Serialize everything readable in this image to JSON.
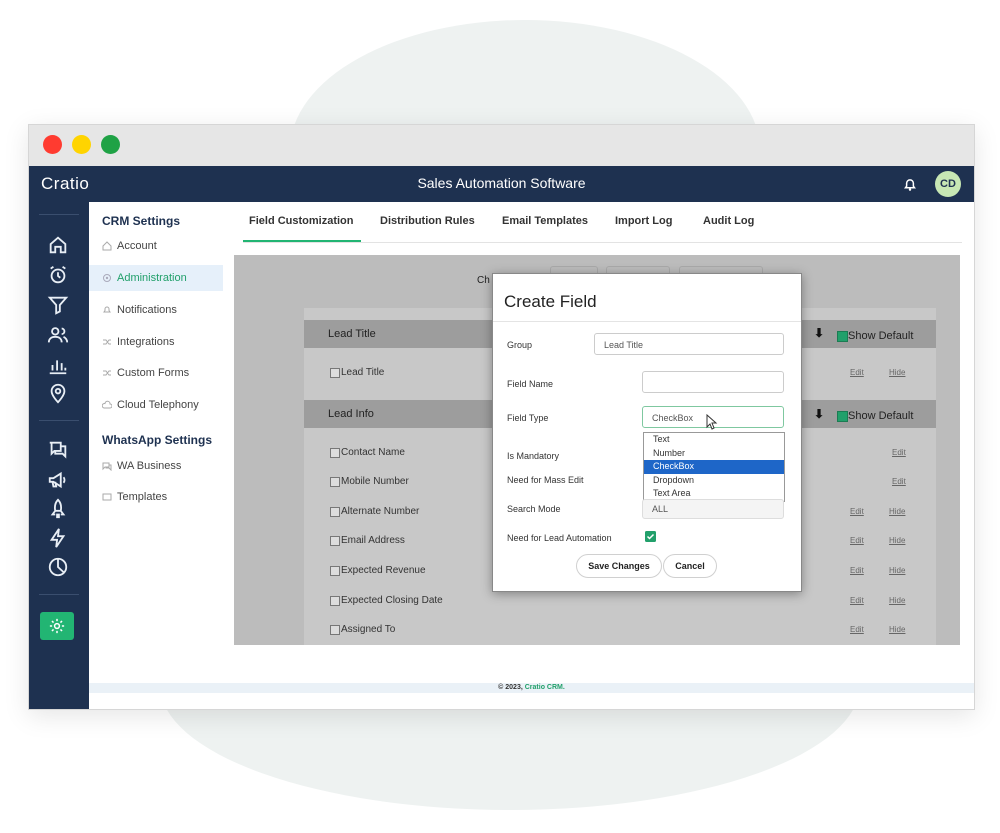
{
  "window": {
    "traffic_colors": [
      "#ff3b30",
      "#ffd400",
      "#1fa245"
    ]
  },
  "topbar": {
    "brand": "Cratio",
    "title": "Sales Automation Software",
    "avatar": "CD"
  },
  "colors": {
    "navy": "#1e3150",
    "accent": "#22b573",
    "active_text": "#22a06b"
  },
  "rail_icons": [
    "home-icon",
    "alarm-icon",
    "filter-icon",
    "users-icon",
    "bar-chart-icon",
    "location-icon",
    "chat-icon",
    "megaphone-icon",
    "rocket-icon",
    "lightning-icon",
    "pie-chart-icon",
    "gear-icon"
  ],
  "settings_nav": {
    "crm_heading": "CRM Settings",
    "crm_items": [
      "Account",
      "Administration",
      "Notifications",
      "Integrations",
      "Custom Forms",
      "Cloud Telephony"
    ],
    "whatsapp_heading": "WhatsApp Settings",
    "whatsapp_items": [
      "WA Business",
      "Templates"
    ]
  },
  "tabs": [
    "Field Customization",
    "Distribution Rules",
    "Email Templates",
    "Import Log",
    "Audit Log"
  ],
  "background": {
    "partial_label": "Ch",
    "show_default": "Show Default",
    "edit": "Edit",
    "hide": "Hide",
    "groups": [
      {
        "title": "Lead Title",
        "fields": [
          "Lead Title"
        ]
      },
      {
        "title": "Lead Info",
        "fields": [
          "Contact Name",
          "Mobile Number",
          "Alternate Number",
          "Email Address",
          "Expected Revenue",
          "Expected Closing Date",
          "Assigned To"
        ]
      }
    ]
  },
  "modal": {
    "title": "Create Field",
    "group_label": "Group",
    "group_value": "Lead Title",
    "field_name_label": "Field Name",
    "field_name_value": "",
    "field_type_label": "Field Type",
    "field_type_value": "CheckBox",
    "field_type_options": [
      "Text",
      "Number",
      "CheckBox",
      "Dropdown",
      "Text Area"
    ],
    "is_mandatory_label": "Is Mandatory",
    "mass_edit_label": "Need for Mass Edit",
    "search_mode_label": "Search Mode",
    "search_mode_value": "ALL",
    "lead_automation_label": "Need for Lead Automation",
    "save_label": "Save Changes",
    "cancel_label": "Cancel"
  },
  "footer": {
    "text": "© 2023, ",
    "brand": "Cratio CRM."
  }
}
